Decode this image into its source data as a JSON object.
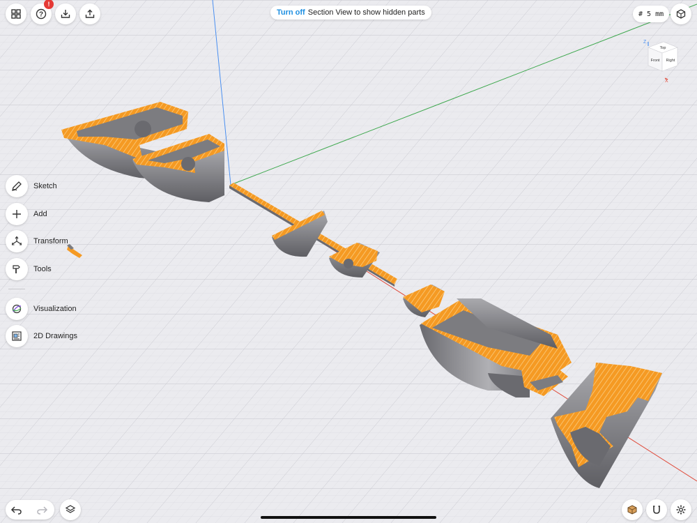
{
  "topbar": {
    "section_notice": {
      "link": "Turn off",
      "text": "Section View to show hidden parts"
    },
    "help_badge": "!",
    "grid_size": "# 5 mm"
  },
  "tools": [
    {
      "label": "Sketch",
      "icon": "pencil-icon"
    },
    {
      "label": "Add",
      "icon": "plus-icon"
    },
    {
      "label": "Transform",
      "icon": "transform-arrows-icon"
    },
    {
      "label": "Tools",
      "icon": "hammer-icon"
    },
    {
      "label": "Visualization",
      "icon": "visualization-icon"
    },
    {
      "label": "2D Drawings",
      "icon": "drawing-icon"
    }
  ],
  "view_cube": {
    "top": "Top",
    "front": "Front",
    "right": "Right",
    "axis_z": "Z",
    "axis_x": "X"
  },
  "colors": {
    "section_fill": "#f59a23",
    "section_hatch": "#fbd38d",
    "part_gray": "#8c8c8c",
    "axis_blue": "#4a8ff0",
    "axis_green": "#3ea84e",
    "axis_red": "#e04a3a",
    "link_blue": "#1e8fe1"
  }
}
